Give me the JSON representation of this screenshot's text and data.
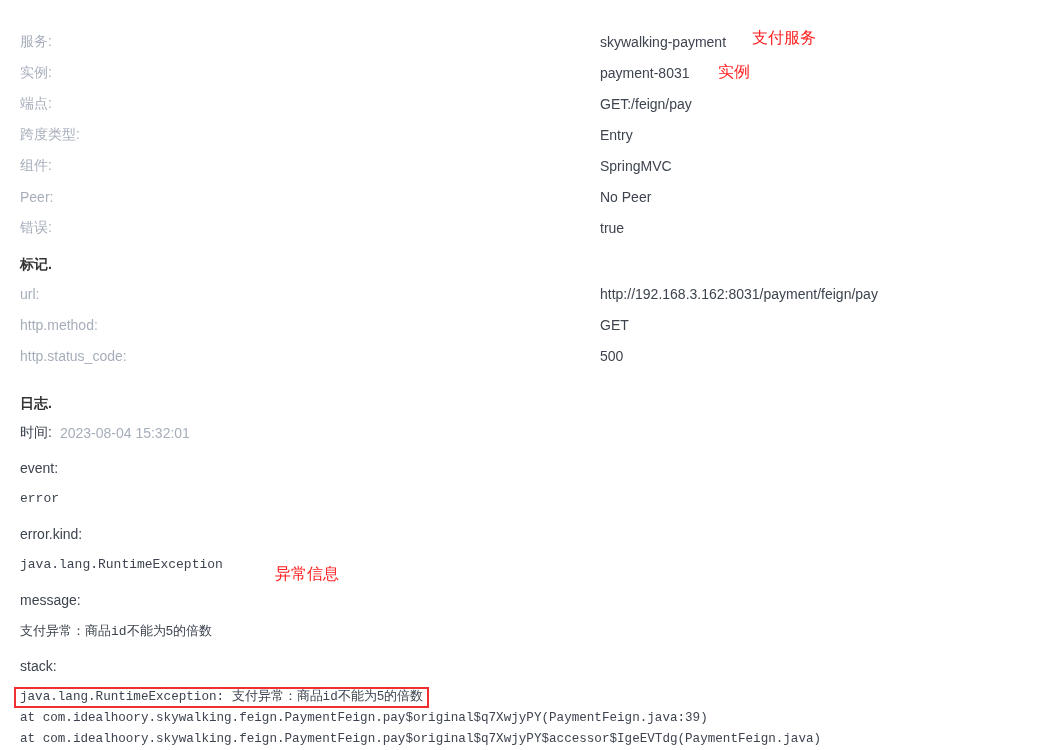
{
  "span_fields": [
    {
      "label": "服务:",
      "value": "skywalking-payment",
      "annotation": "支付服务"
    },
    {
      "label": "实例:",
      "value": "payment-8031",
      "annotation": "实例"
    },
    {
      "label": "端点:",
      "value": "GET:/feign/pay"
    },
    {
      "label": "跨度类型:",
      "value": "Entry"
    },
    {
      "label": "组件:",
      "value": "SpringMVC"
    },
    {
      "label": "Peer:",
      "value": "No Peer"
    },
    {
      "label": "错误:",
      "value": "true"
    }
  ],
  "tags": {
    "title": "标记.",
    "fields": [
      {
        "label": "url:",
        "value": "http://192.168.3.162:8031/payment/feign/pay"
      },
      {
        "label": "http.method:",
        "value": "GET"
      },
      {
        "label": "http.status_code:",
        "value": "500"
      }
    ]
  },
  "logs": {
    "title": "日志.",
    "time_label": "时间:",
    "time": "2023-08-04 15:32:01",
    "entries": [
      {
        "key": "event:",
        "value": "error"
      },
      {
        "key": "error.kind:",
        "value": "java.lang.RuntimeException",
        "annotation": "异常信息"
      },
      {
        "key": "message:",
        "value": "支付异常：商品id不能为5的倍数"
      }
    ],
    "stack": {
      "key": "stack:",
      "lines": [
        {
          "text": "java.lang.RuntimeException: 支付异常：商品id不能为5的倍数",
          "highlighted": true
        },
        {
          "text": "at com.idealhoory.skywalking.feign.PaymentFeign.pay$original$q7XwjyPY(PaymentFeign.java:39)",
          "highlighted": false
        },
        {
          "text": "at com.idealhoory.skywalking.feign.PaymentFeign.pay$original$q7XwjyPY$accessor$IgeEVTdg(PaymentFeign.java)",
          "highlighted": false
        }
      ]
    }
  }
}
